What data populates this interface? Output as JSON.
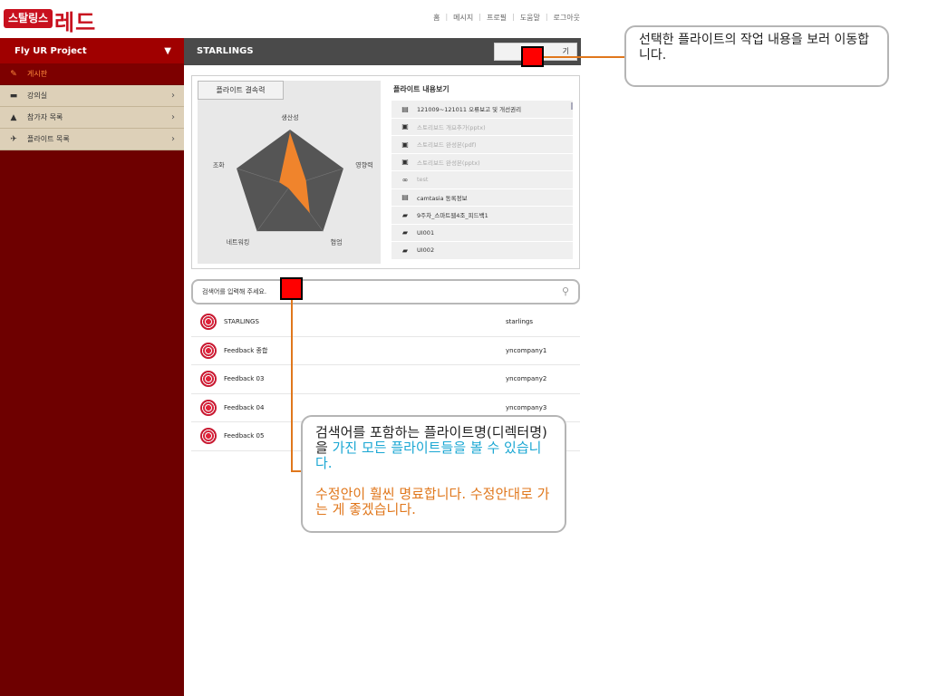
{
  "header": {
    "logo_badge": "스탈링스",
    "logo_text": "레드",
    "nav": [
      "홈",
      "메시지",
      "프로필",
      "도움말",
      "로그아웃"
    ]
  },
  "sidebar": {
    "project": "Fly UR Project",
    "project_arrow": "▼",
    "items": [
      {
        "label": "게시판",
        "icon": "edit-icon",
        "active": true
      },
      {
        "label": "강의실",
        "icon": "book-icon"
      },
      {
        "label": "참가자 목록",
        "icon": "person-icon"
      },
      {
        "label": "플라이트 목록",
        "icon": "plane-icon"
      }
    ]
  },
  "main": {
    "title": "STARLINGS",
    "view_button": "기",
    "chart_tab": "플라이트 결속력",
    "content_title": "플라이트 내용보기",
    "content_items": [
      {
        "label": "121009~121011 오류보고 및 개선권리",
        "icon": "document-icon",
        "dim": false
      },
      {
        "label": "스토리보드 개요추가(pptx)",
        "icon": "file-icon",
        "dim": true
      },
      {
        "label": "스토리보드 완성본(pdf)",
        "icon": "file-icon",
        "dim": true
      },
      {
        "label": "스토리보드 완성본(pptx)",
        "icon": "file-icon",
        "dim": true
      },
      {
        "label": "test",
        "icon": "link-icon",
        "dim": true
      },
      {
        "label": "camtasia 동록정보",
        "icon": "document-icon",
        "dim": false
      },
      {
        "label": "9주차_스마트웹4조_피드백1",
        "icon": "image-icon",
        "dim": false
      },
      {
        "label": "UI001",
        "icon": "image-icon",
        "dim": false
      },
      {
        "label": "UI002",
        "icon": "image-icon",
        "dim": false
      }
    ],
    "search_placeholder": "검색어를 입력해 주세요.",
    "results": [
      {
        "name": "STARLINGS",
        "id": "starlings"
      },
      {
        "name": "Feedback 종합",
        "id": "yncompany1"
      },
      {
        "name": "Feedback 03",
        "id": "yncompany2"
      },
      {
        "name": "Feedback 04",
        "id": "yncompany3"
      },
      {
        "name": "Feedback 05",
        "id": ""
      }
    ]
  },
  "chart_data": {
    "type": "radar",
    "axes": [
      "생산성",
      "영향력",
      "협업",
      "네트워킹",
      "조화"
    ],
    "series": [
      {
        "values": [
          0.95,
          0.3,
          0.6,
          0.05,
          0.2
        ]
      }
    ],
    "colors": {
      "background": "#555555",
      "series": "#f0842c"
    }
  },
  "annotations": {
    "callout1": "선택한 플라이트의 작업 내용을 보러 이동합니다.",
    "callout2_part1": "검색어를 포함하는 플라이트명(디렉터명)을",
    "callout2_part2": "가진 모든 플라이트들을 볼 수 있습니다.",
    "callout2_part3": "수정안이 훨씬 명료합니다. 수정안대로 가는 게 좋겠습니다.",
    "colors": {
      "marker": "#ff0000",
      "connector": "#e0771c",
      "blue": "#1aa7d3",
      "orange": "#e0771c"
    }
  }
}
